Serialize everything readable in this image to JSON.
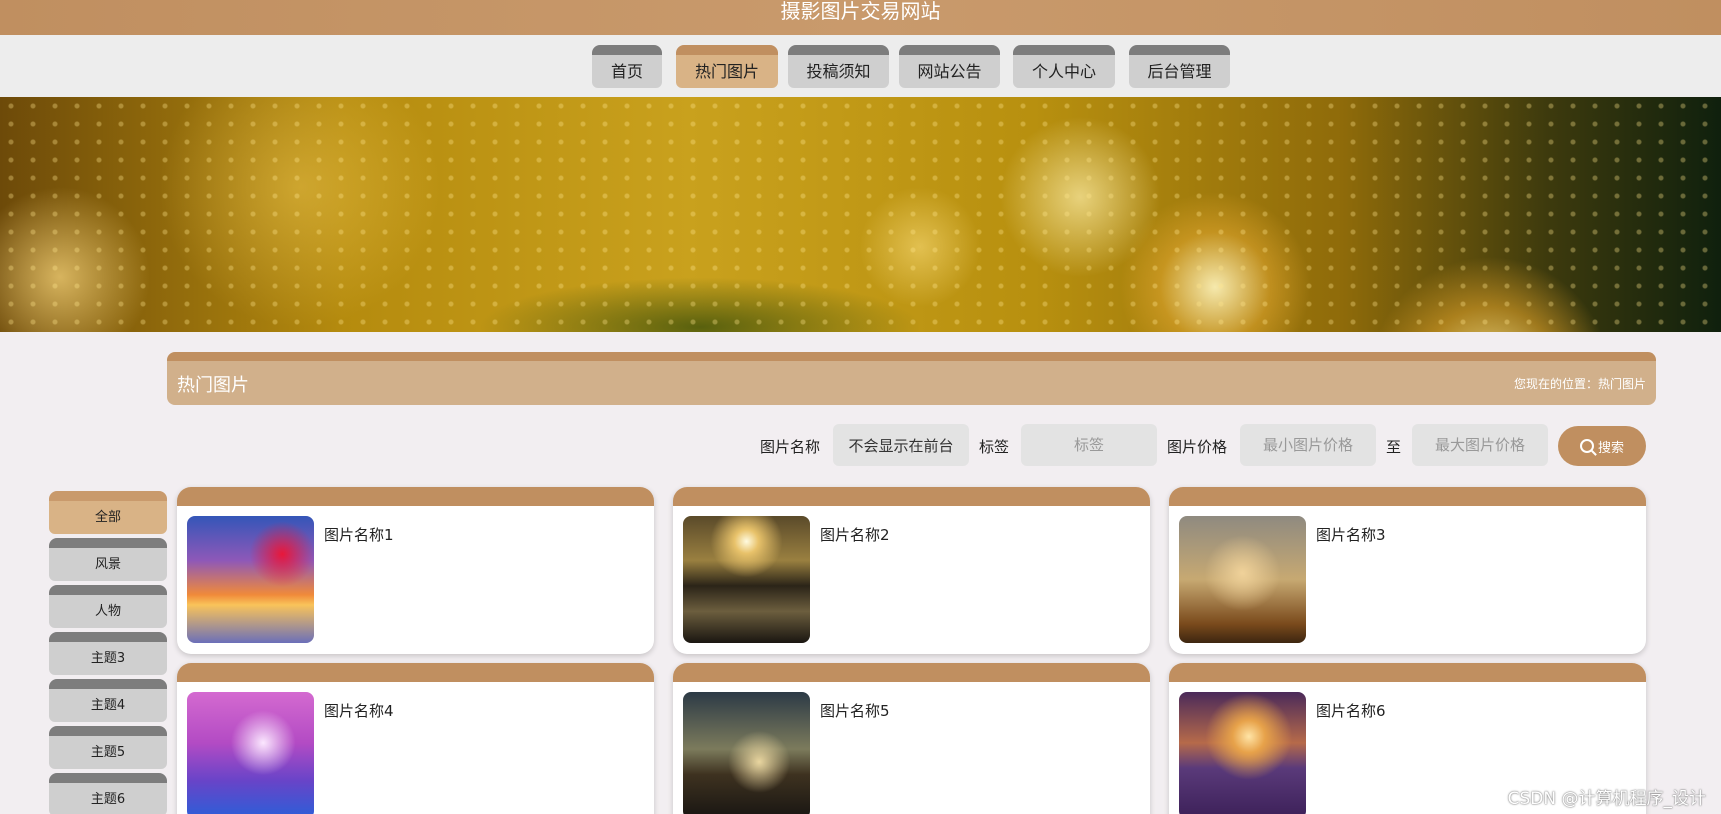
{
  "site": {
    "title": "摄影图片交易网站"
  },
  "nav": {
    "items": [
      {
        "label": "首页"
      },
      {
        "label": "热门图片"
      },
      {
        "label": "投稿须知"
      },
      {
        "label": "网站公告"
      },
      {
        "label": "个人中心"
      },
      {
        "label": "后台管理"
      }
    ],
    "active": "热门图片"
  },
  "section": {
    "title": "热门图片",
    "breadcrumb": "您现在的位置：热门图片"
  },
  "search": {
    "name_label": "图片名称",
    "name_value": "不会显示在前台",
    "tag_label": "标签",
    "tag_placeholder": "标签",
    "price_label": "图片价格",
    "min_placeholder": "最小图片价格",
    "to_label": "至",
    "max_placeholder": "最大图片价格",
    "button_label": "搜索"
  },
  "categories": [
    {
      "label": "全部"
    },
    {
      "label": "风景"
    },
    {
      "label": "人物"
    },
    {
      "label": "主题3"
    },
    {
      "label": "主题4"
    },
    {
      "label": "主题5"
    },
    {
      "label": "主题6"
    }
  ],
  "cards": [
    {
      "name": "图片名称1"
    },
    {
      "name": "图片名称2"
    },
    {
      "name": "图片名称3"
    },
    {
      "name": "图片名称4"
    },
    {
      "name": "图片名称5"
    },
    {
      "name": "图片名称6"
    }
  ],
  "watermark": "CSDN @计算机程序_设计",
  "colors": {
    "accent": "#c08f60",
    "accent_light": "#d9b386",
    "tab_inactive": "#cfcfcf"
  }
}
